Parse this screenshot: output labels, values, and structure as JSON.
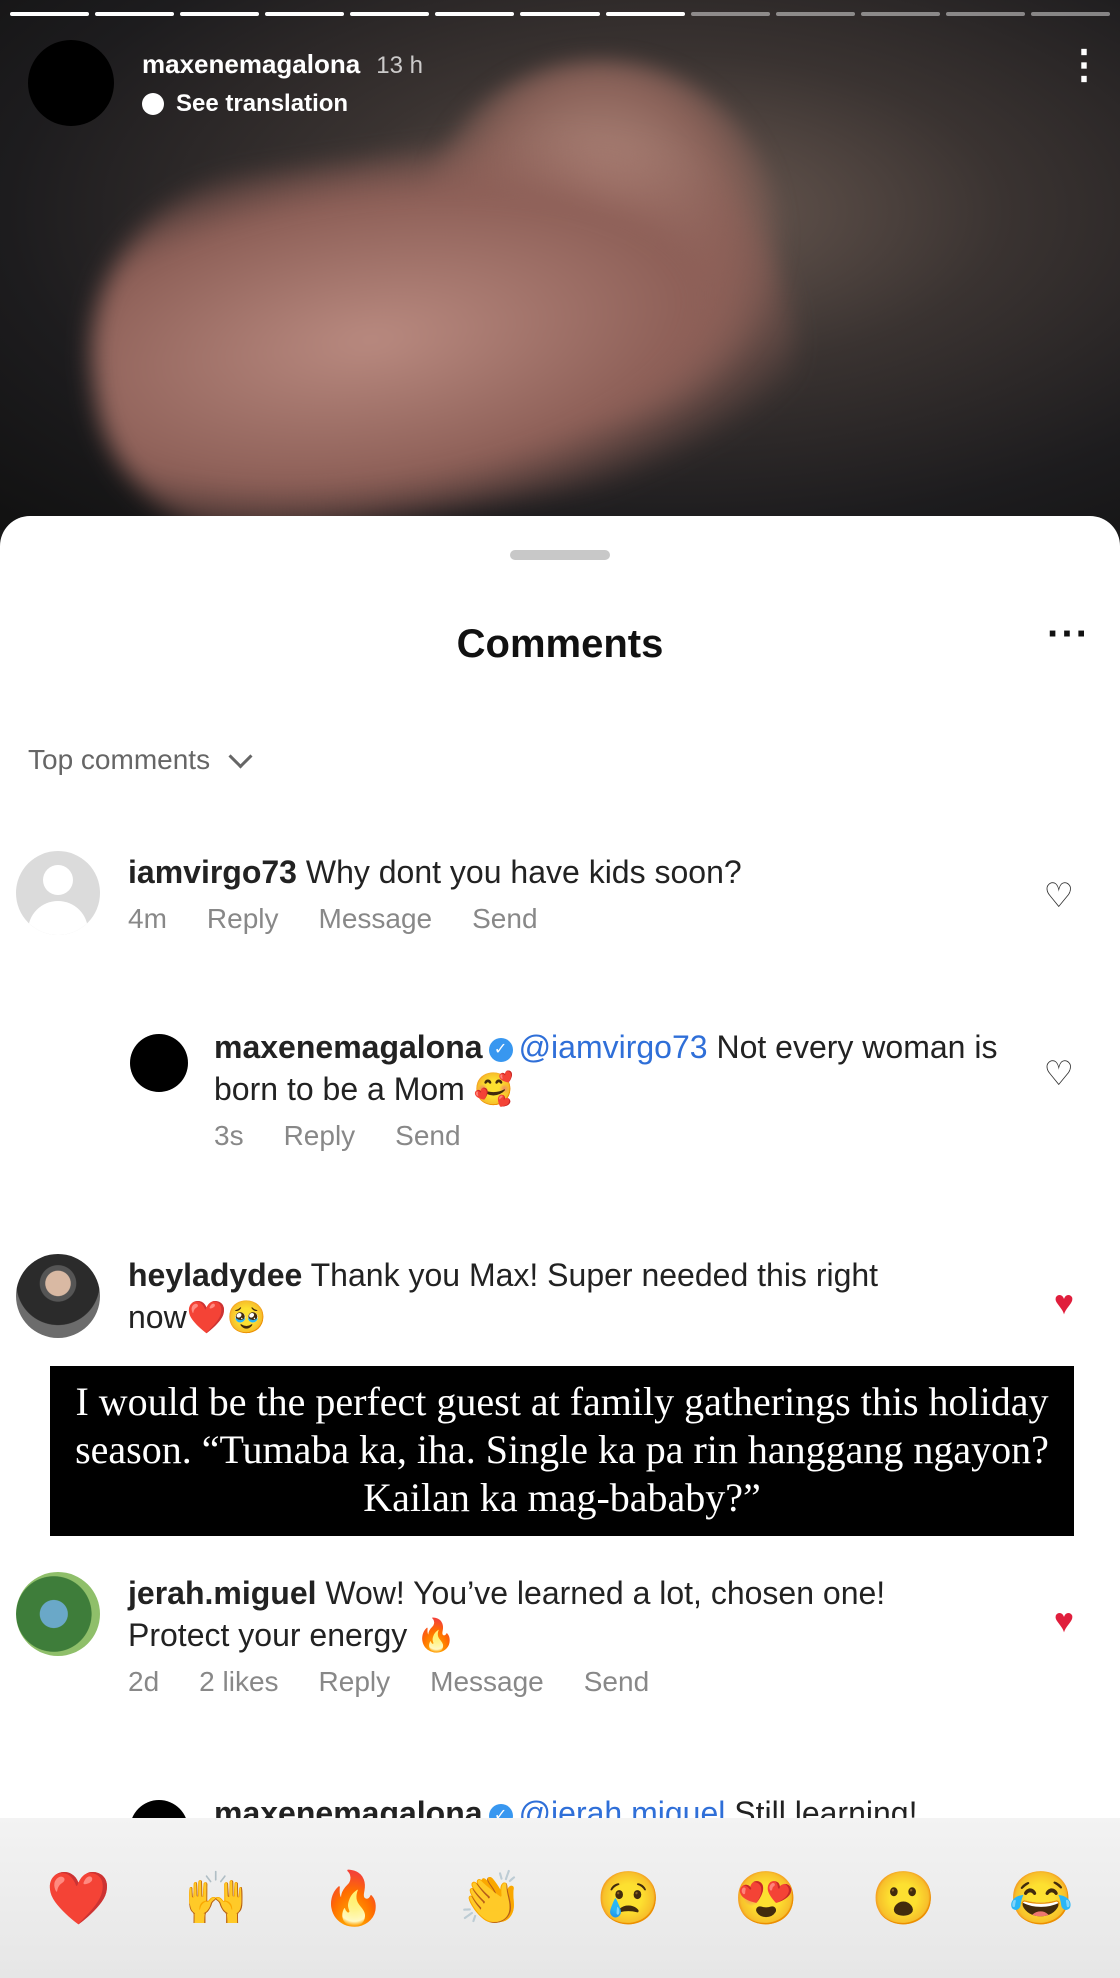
{
  "story": {
    "username": "maxenemagalona",
    "time": "13 h",
    "translate_label": "See translation",
    "more_icon": "⋮",
    "progress_segments": 13,
    "progress_done": 8
  },
  "sheet": {
    "title": "Comments",
    "more_icon": "···",
    "sort_label": "Top comments"
  },
  "comments": [
    {
      "username": "iamvirgo73",
      "text": "Why dont you have kids soon?",
      "time": "4m",
      "actions": [
        "Reply",
        "Message",
        "Send"
      ],
      "liked": false
    },
    {
      "username": "maxenemagalona",
      "mention": "@iamvirgo73",
      "text": "Not every woman is born to be a Mom 🥰",
      "time": "3s",
      "actions": [
        "Reply",
        "Send"
      ],
      "liked": false
    },
    {
      "username": "heyladydee",
      "text": "Thank you Max! Super needed this right now❤️🥹",
      "liked": true
    },
    {
      "username": "jerah.miguel",
      "text": "Wow! You’ve learned a lot, chosen one! Protect your energy 🔥",
      "time": "2d",
      "likes": "2 likes",
      "actions": [
        "Reply",
        "Message",
        "Send"
      ],
      "liked": true
    },
    {
      "username": "maxenemagalona",
      "mention": "@jerah.miguel",
      "text": "Still learning! Forever learning 🙏 Thank you!",
      "liked": false
    }
  ],
  "caption_overlay": "I would be the perfect guest at family gatherings this holiday season. “Tumaba ka, iha. Single ka pa rin hanggang ngayon? Kailan ka mag-bababy?”",
  "emoji_bar": [
    "❤️",
    "🙌",
    "🔥",
    "👏",
    "😢",
    "😍",
    "😮",
    "😂"
  ],
  "colors": {
    "like_red": "#e01e3c",
    "mention_blue": "#2f6fd8",
    "verified_blue": "#3897f0"
  }
}
